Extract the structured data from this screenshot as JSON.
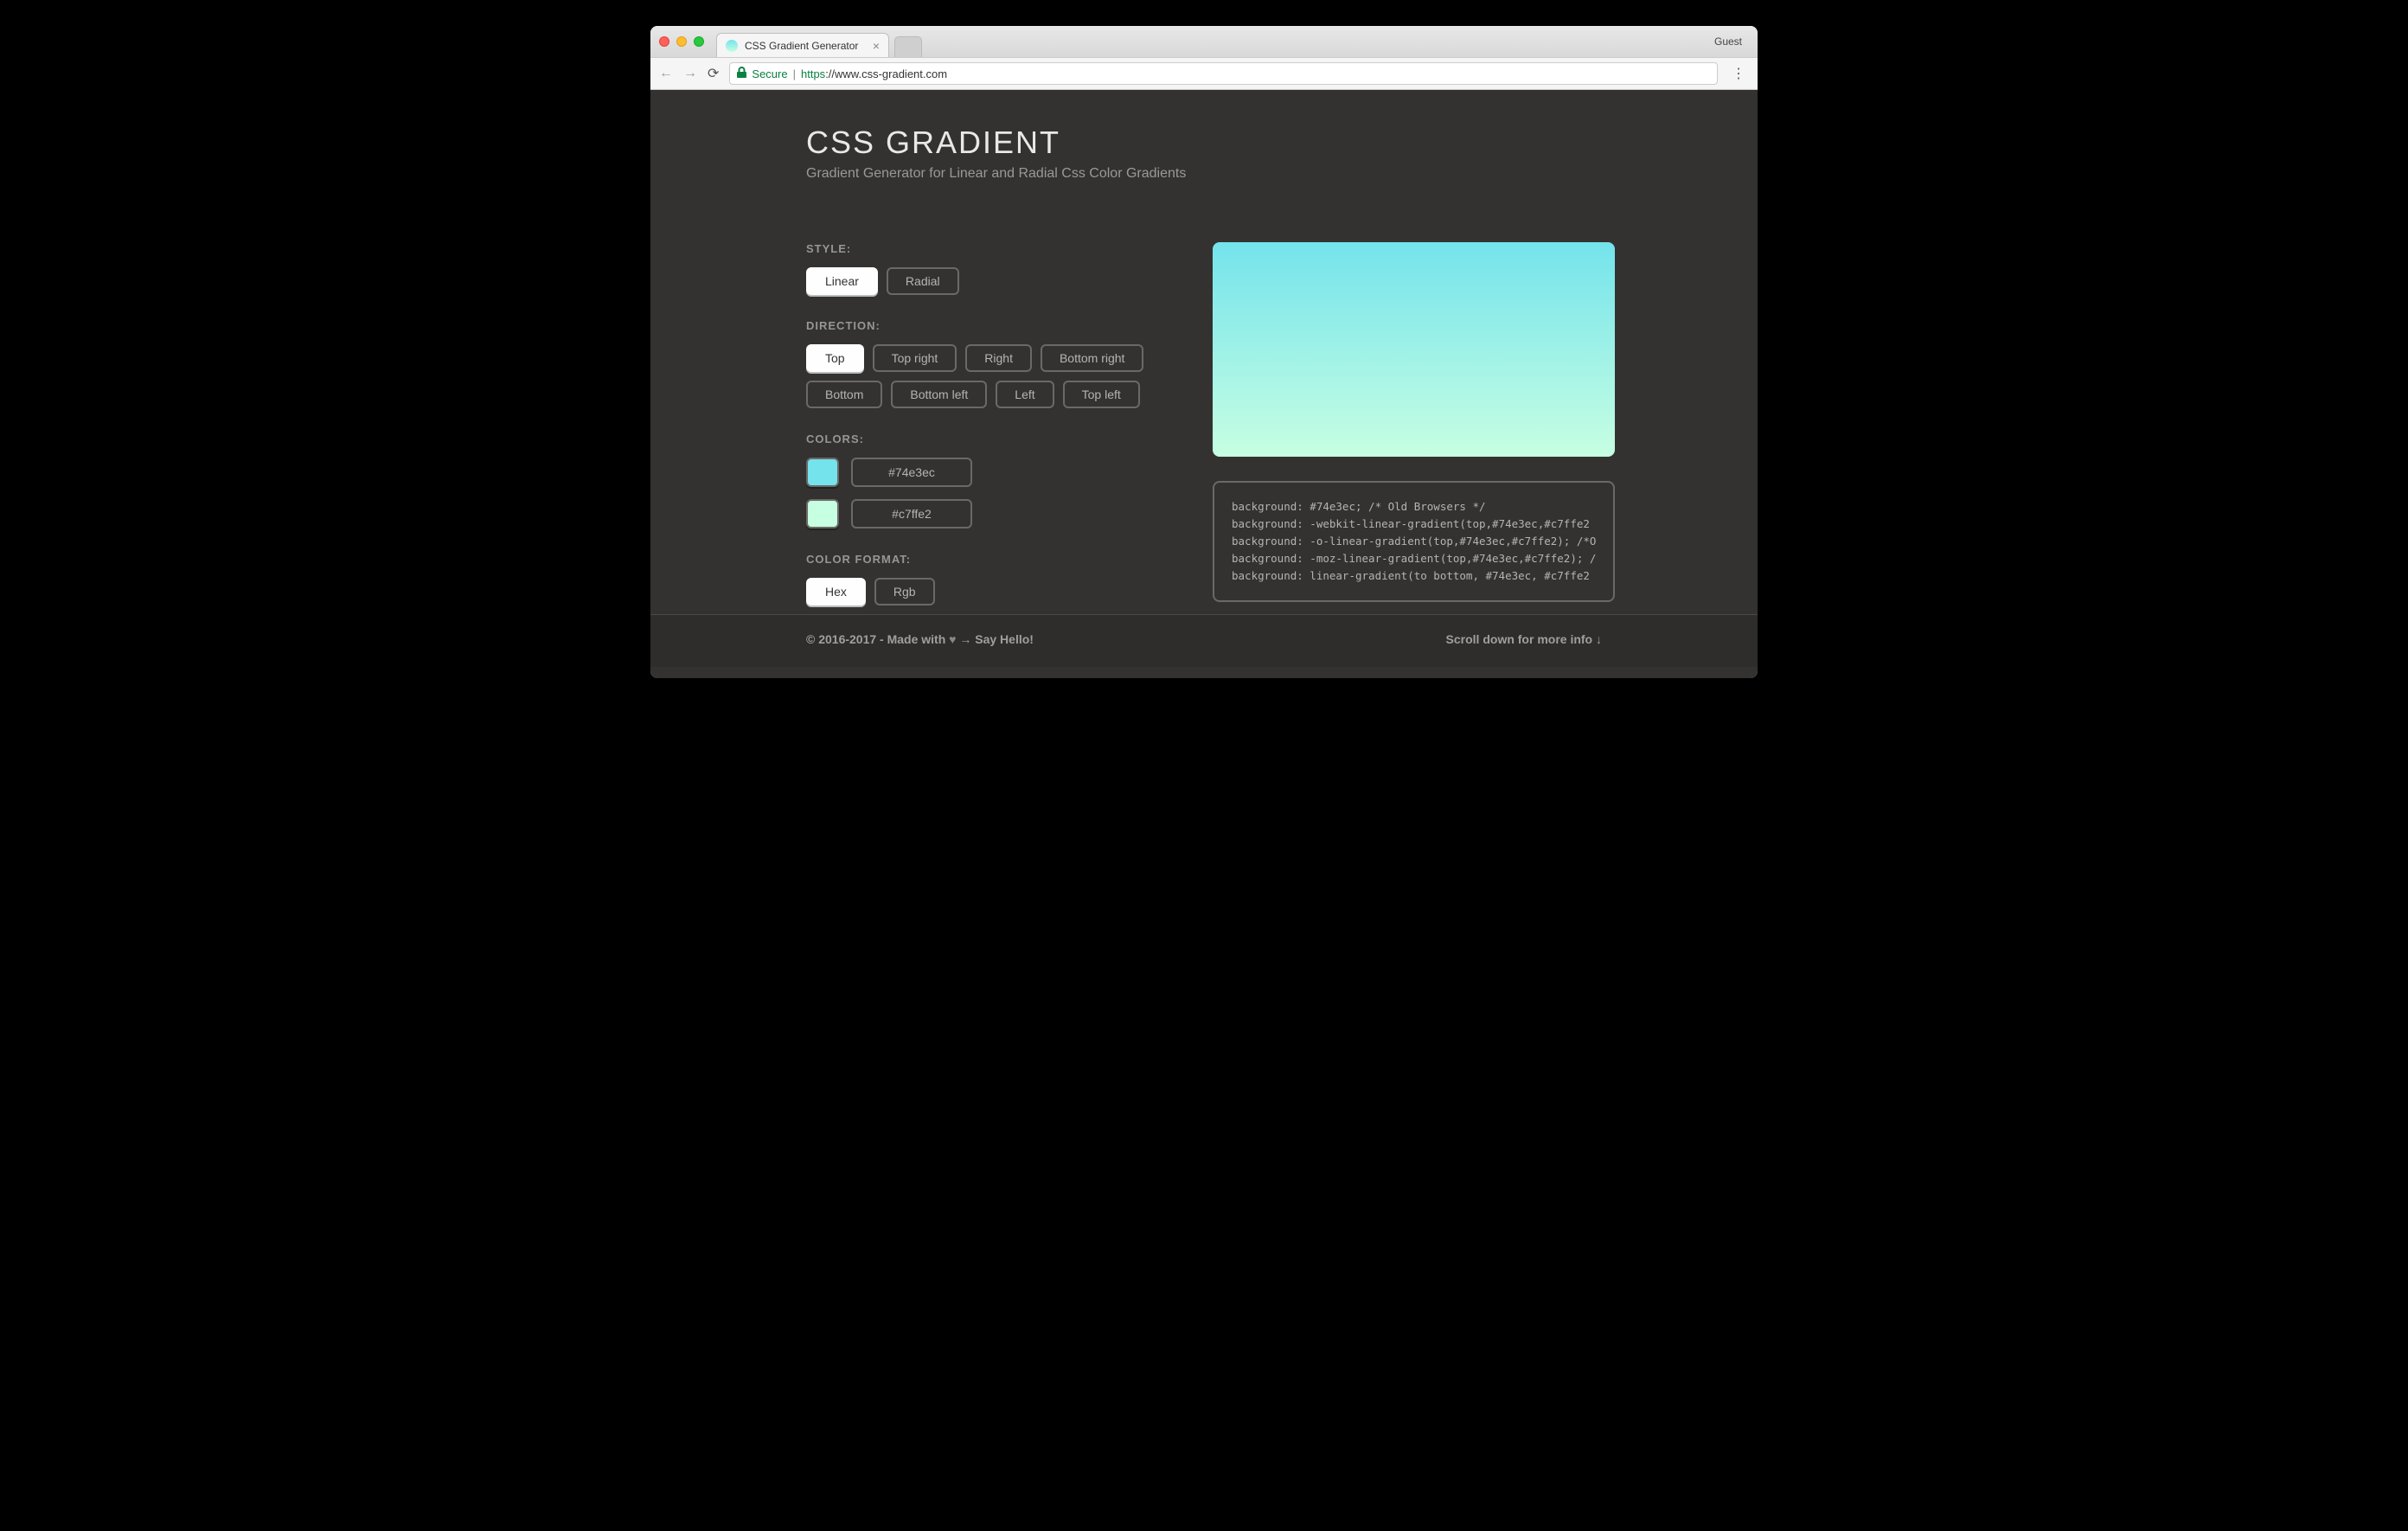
{
  "browser": {
    "tab_title": "CSS Gradient Generator",
    "guest_label": "Guest",
    "secure_label": "Secure",
    "url_protocol": "https",
    "url_rest": "://www.css-gradient.com"
  },
  "header": {
    "title": "CSS GRADIENT",
    "subtitle": "Gradient Generator for Linear and Radial Css Color Gradients"
  },
  "style": {
    "label": "STYLE:",
    "options": [
      {
        "label": "Linear",
        "active": true
      },
      {
        "label": "Radial",
        "active": false
      }
    ]
  },
  "direction": {
    "label": "DIRECTION:",
    "options": [
      {
        "label": "Top",
        "active": true
      },
      {
        "label": "Top right",
        "active": false
      },
      {
        "label": "Right",
        "active": false
      },
      {
        "label": "Bottom right",
        "active": false
      },
      {
        "label": "Bottom",
        "active": false
      },
      {
        "label": "Bottom left",
        "active": false
      },
      {
        "label": "Left",
        "active": false
      },
      {
        "label": "Top left",
        "active": false
      }
    ]
  },
  "colors": {
    "label": "COLORS:",
    "c1": {
      "hex": "#74e3ec"
    },
    "c2": {
      "hex": "#c7ffe2"
    }
  },
  "format": {
    "label": "COLOR FORMAT:",
    "options": [
      {
        "label": "Hex",
        "active": true
      },
      {
        "label": "Rgb",
        "active": false
      }
    ]
  },
  "code": {
    "line1": "background: #74e3ec; /* Old Browsers */",
    "line2": "background: -webkit-linear-gradient(top,#74e3ec,#c7ffe2",
    "line3": "background: -o-linear-gradient(top,#74e3ec,#c7ffe2); /*O",
    "line4": "background: -moz-linear-gradient(top,#74e3ec,#c7ffe2); /",
    "line5": "background: linear-gradient(to bottom, #74e3ec, #c7ffe2"
  },
  "footer": {
    "left_a": "© 2016-2017 - Made with ",
    "left_b": " → Say Hello!",
    "right": "Scroll down for more info ↓"
  }
}
